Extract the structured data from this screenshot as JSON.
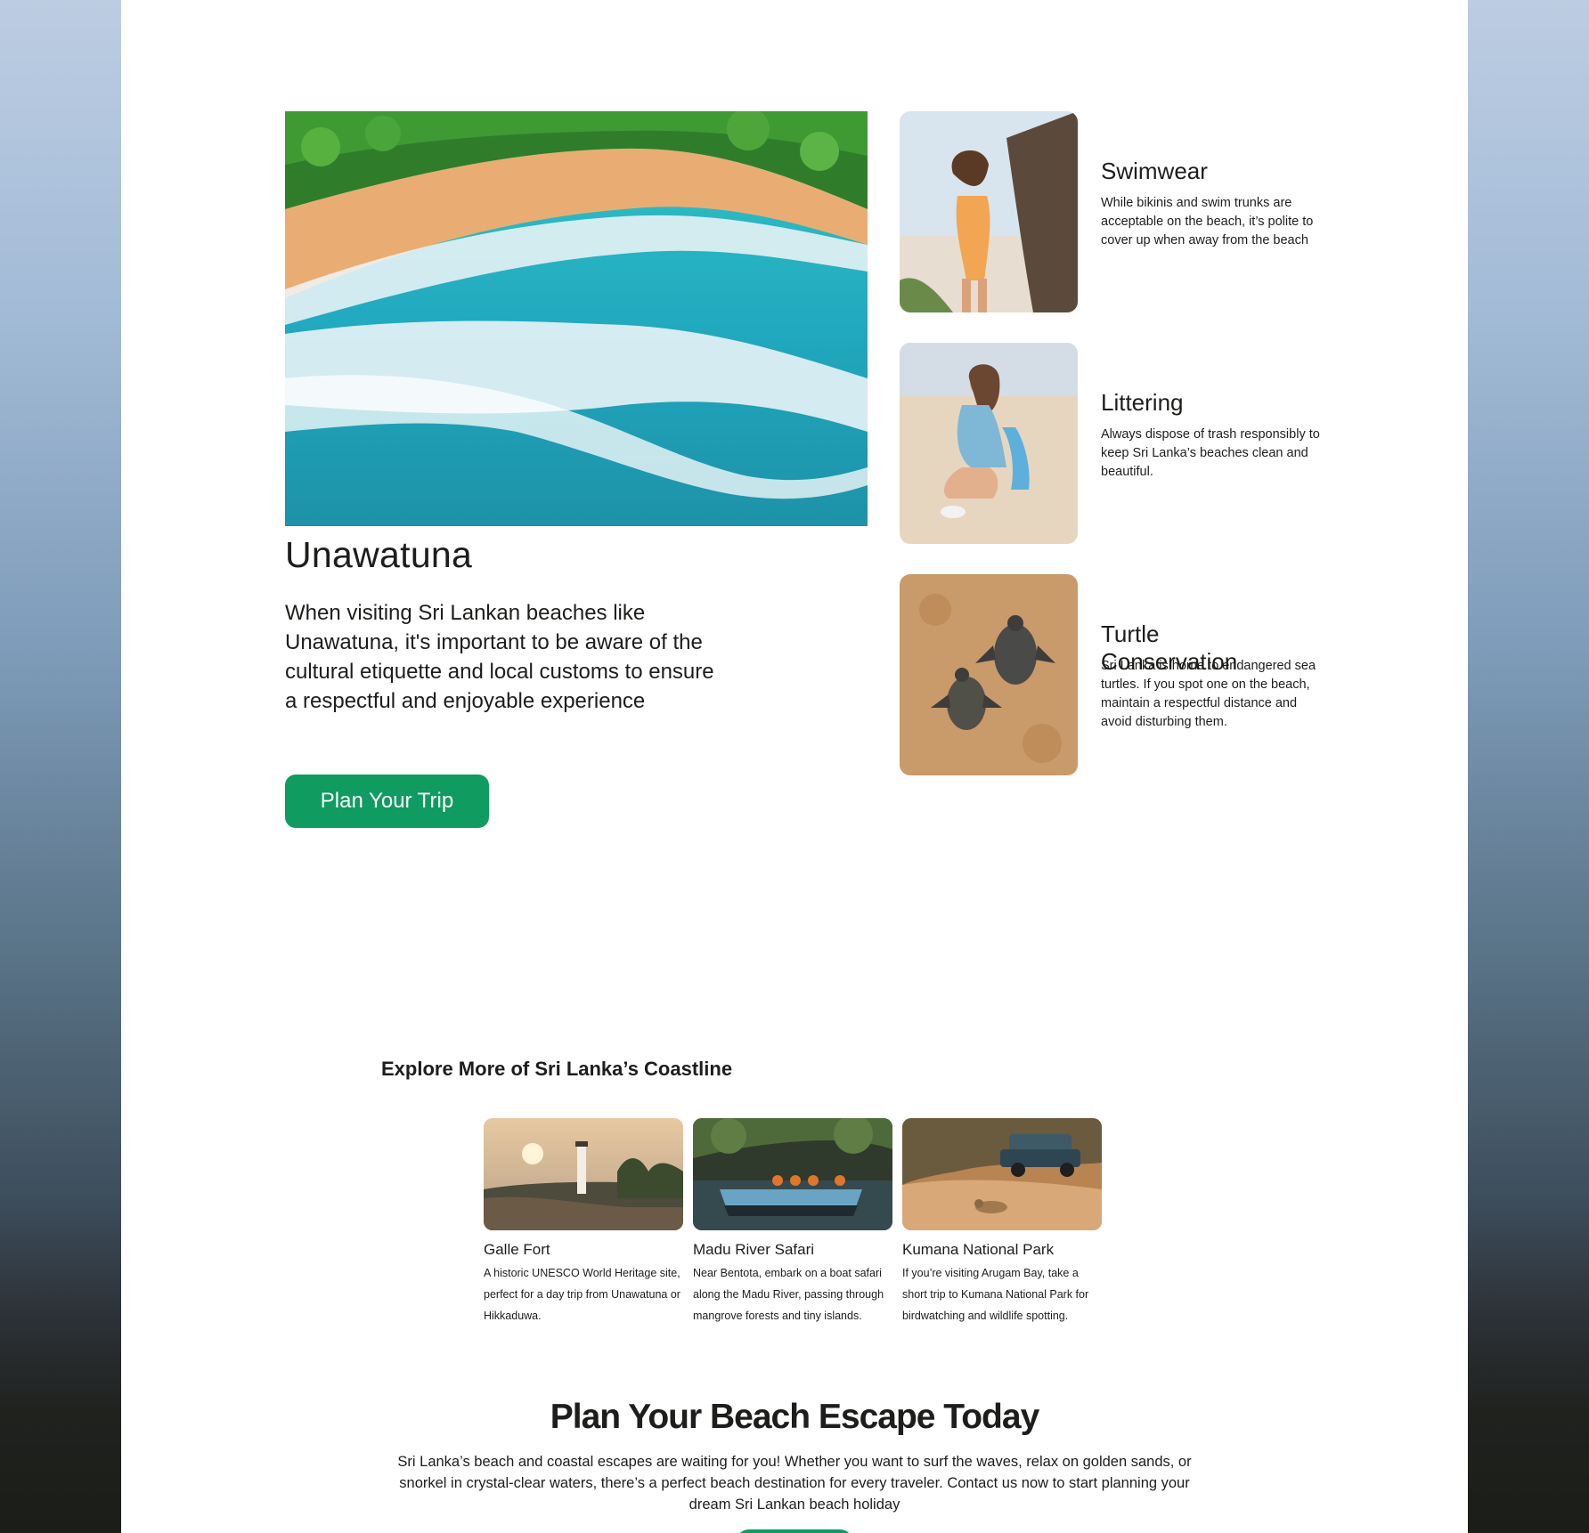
{
  "hero": {
    "image_alt": "Aerial view of Unawatuna beach with turquoise waves",
    "title": "Unawatuna",
    "description": "When visiting Sri Lankan beaches like Unawatuna, it's important to be aware of the cultural etiquette and local customs to ensure a respectful and enjoyable experience",
    "button_label": "Plan Your Trip"
  },
  "tips": [
    {
      "title": "Swimwear",
      "text": "While bikinis and swim trunks are acceptable on the beach, it’s polite to cover up when away from the beach"
    },
    {
      "title": "Littering",
      "text": "Always dispose of trash responsibly to keep Sri Lanka’s beaches clean and beautiful."
    },
    {
      "title": "Turtle Conservation",
      "text": "Sri Lanka is home to endangered sea turtles. If you spot one on the beach, maintain a respectful distance and avoid disturbing them."
    }
  ],
  "explore": {
    "title": "Explore More of Sri Lanka’s Coastline",
    "cards": [
      {
        "title": "Galle Fort",
        "text": "A historic UNESCO World Heritage site, perfect for a day trip from Unawatuna or Hikkaduwa."
      },
      {
        "title": "Madu River Safari",
        "text": "Near Bentota, embark on a boat safari along the Madu River, passing through mangrove forests and tiny islands."
      },
      {
        "title": "Kumana National Park",
        "text": "If you’re visiting Arugam Bay, take a short trip to Kumana National Park for birdwatching and wildlife spotting."
      }
    ]
  },
  "cta": {
    "title": "Plan Your Beach Escape Today",
    "text": "Sri Lanka’s beach and coastal escapes are waiting for you! Whether you want to surf the waves, relax on golden sands, or snorkel in crystal-clear waters, there’s a perfect beach destination for every traveler. Contact us now to start planning your dream Sri Lankan beach holiday"
  },
  "colors": {
    "accent": "#109b61",
    "text": "#1d1d1b"
  }
}
